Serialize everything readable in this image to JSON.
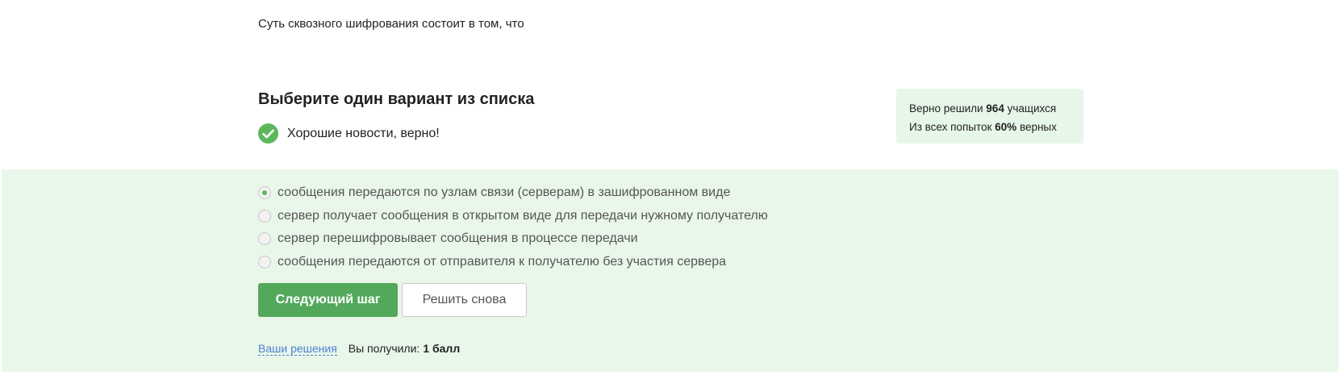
{
  "question": {
    "text": "Суть сквозного шифрования состоит в том, что"
  },
  "quiz": {
    "heading": "Выберите один вариант из списка",
    "feedback": "Хорошие новости, верно!"
  },
  "stats": {
    "line1_prefix": "Верно решили ",
    "solved_count": "964",
    "line1_suffix": " учащихся",
    "line2_prefix": "Из всех попыток ",
    "correct_percent": "60%",
    "line2_suffix": " верных"
  },
  "options": [
    {
      "label": "сообщения передаются по узлам связи (серверам) в зашифрованном виде",
      "selected": true
    },
    {
      "label": "сервер получает сообщения в открытом виде для передачи нужному получателю",
      "selected": false
    },
    {
      "label": "сервер перешифровывает сообщения в процессе передачи",
      "selected": false
    },
    {
      "label": "сообщения передаются от отправителя к получателю без участия сервера",
      "selected": false
    }
  ],
  "actions": {
    "next_label": "Следующий шаг",
    "retry_label": "Решить снова"
  },
  "footer": {
    "solutions_link": "Ваши решения",
    "score_label": "Вы получили:",
    "score_value": "1 балл"
  },
  "colors": {
    "accent_green": "#52a95b",
    "panel_bg": "#e8f7e9",
    "stats_bg": "#e6f6e8",
    "link_blue": "#4e7fd6"
  }
}
